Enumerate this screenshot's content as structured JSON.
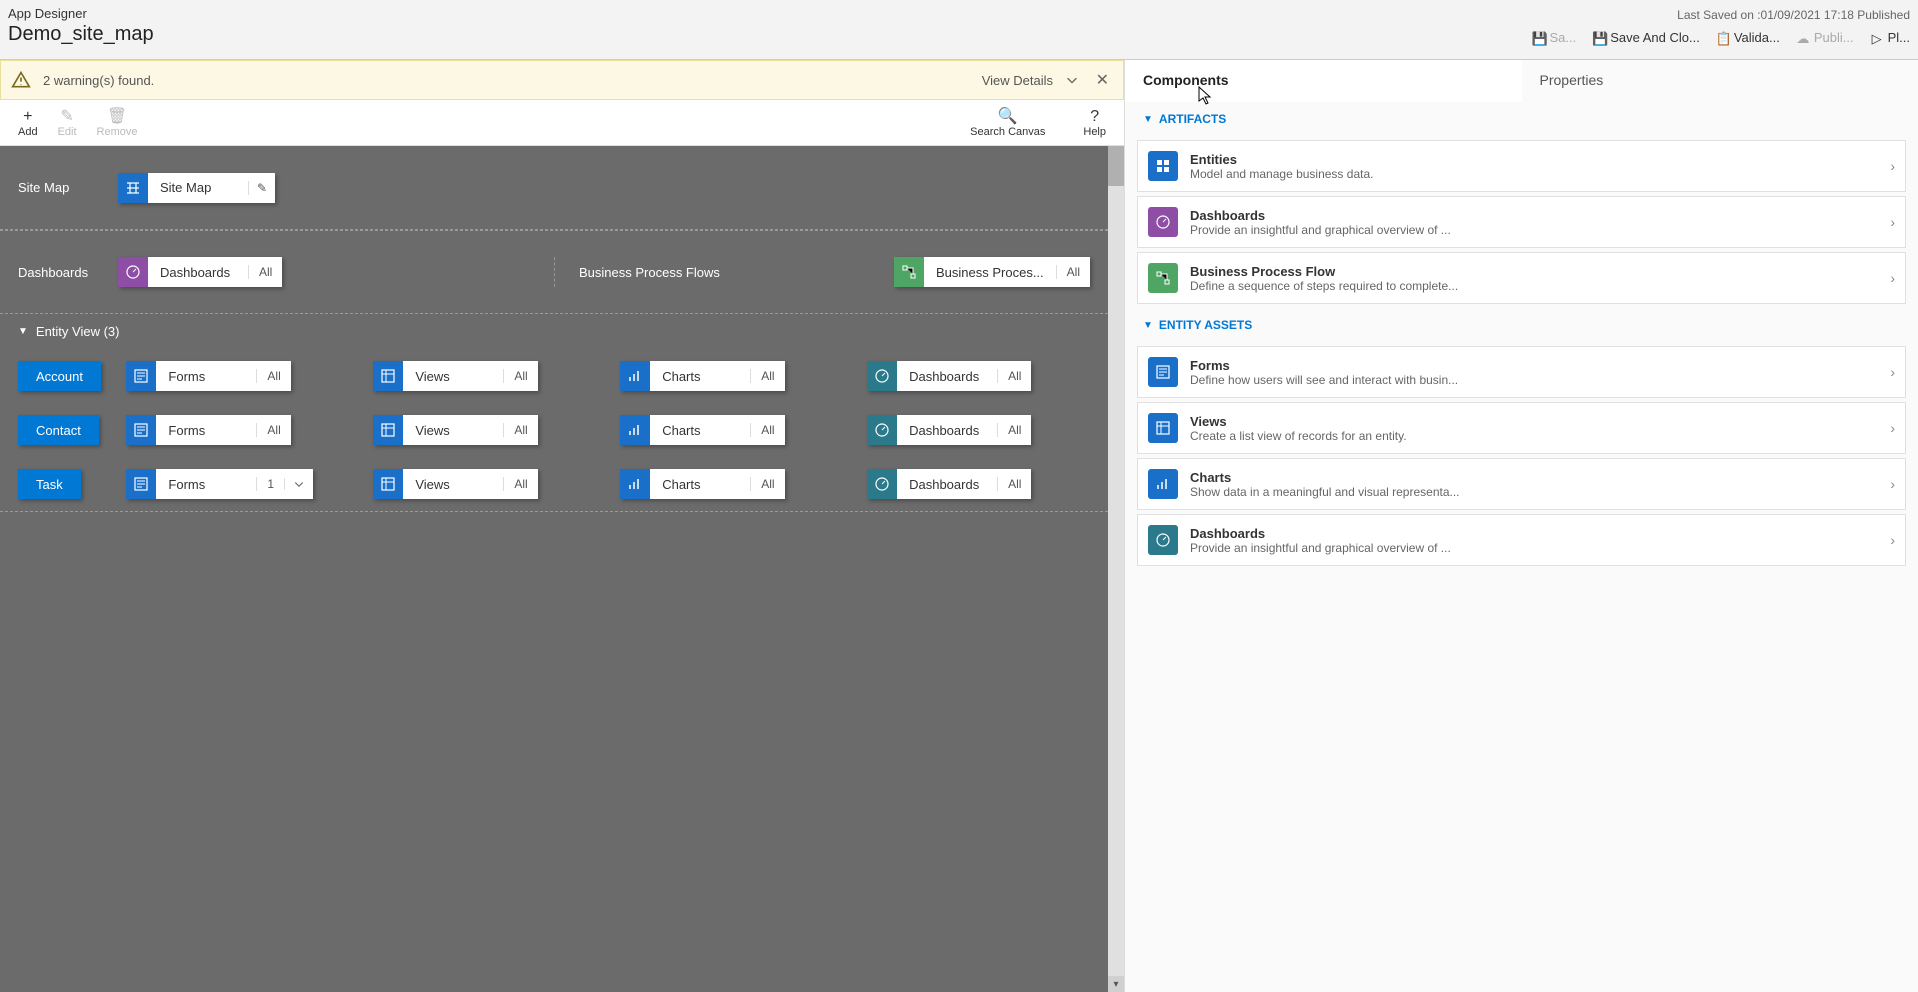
{
  "header": {
    "app_title": "App Designer",
    "app_name": "Demo_site_map",
    "last_saved": "Last Saved on :01/09/2021 17:18 Published",
    "actions": {
      "save": "Sa...",
      "save_close": "Save And Clo...",
      "validate": "Valida...",
      "publish": "Publi...",
      "play": "Pl..."
    }
  },
  "warning": {
    "text": "2 warning(s) found.",
    "view_details": "View Details"
  },
  "toolbar": {
    "add": "Add",
    "edit": "Edit",
    "remove": "Remove",
    "search": "Search Canvas",
    "help": "Help"
  },
  "canvas": {
    "site_map_label": "Site Map",
    "site_map_tile": "Site Map",
    "dashboards_label": "Dashboards",
    "dashboards_tile": "Dashboards",
    "dashboards_badge": "All",
    "bpf_label": "Business Process Flows",
    "bpf_tile": "Business Proces...",
    "bpf_badge": "All",
    "entity_view_label": "Entity View (3)",
    "entities": [
      {
        "name": "Account",
        "forms": "Forms",
        "forms_b": "All",
        "views": "Views",
        "views_b": "All",
        "charts": "Charts",
        "charts_b": "All",
        "dash": "Dashboards",
        "dash_b": "All"
      },
      {
        "name": "Contact",
        "forms": "Forms",
        "forms_b": "All",
        "views": "Views",
        "views_b": "All",
        "charts": "Charts",
        "charts_b": "All",
        "dash": "Dashboards",
        "dash_b": "All"
      },
      {
        "name": "Task",
        "forms": "Forms",
        "forms_b": "1",
        "views": "Views",
        "views_b": "All",
        "charts": "Charts",
        "charts_b": "All",
        "dash": "Dashboards",
        "dash_b": "All"
      }
    ]
  },
  "sidebar": {
    "tabs": {
      "components": "Components",
      "properties": "Properties"
    },
    "groups": {
      "artifacts": "ARTIFACTS",
      "entity_assets": "ENTITY ASSETS"
    },
    "artifacts": [
      {
        "title": "Entities",
        "desc": "Model and manage business data.",
        "color": "blue-ic",
        "icon": "grid"
      },
      {
        "title": "Dashboards",
        "desc": "Provide an insightful and graphical overview of ...",
        "color": "purple-ic",
        "icon": "gauge"
      },
      {
        "title": "Business Process Flow",
        "desc": "Define a sequence of steps required to complete...",
        "color": "green-ic",
        "icon": "flow"
      }
    ],
    "entity_assets": [
      {
        "title": "Forms",
        "desc": "Define how users will see and interact with busin...",
        "color": "blue-ic",
        "icon": "form"
      },
      {
        "title": "Views",
        "desc": "Create a list view of records for an entity.",
        "color": "blue-ic",
        "icon": "list"
      },
      {
        "title": "Charts",
        "desc": "Show data in a meaningful and visual representa...",
        "color": "blue-ic",
        "icon": "chart"
      },
      {
        "title": "Dashboards",
        "desc": "Provide an insightful and graphical overview of ...",
        "color": "teal-ic",
        "icon": "gauge"
      }
    ]
  }
}
